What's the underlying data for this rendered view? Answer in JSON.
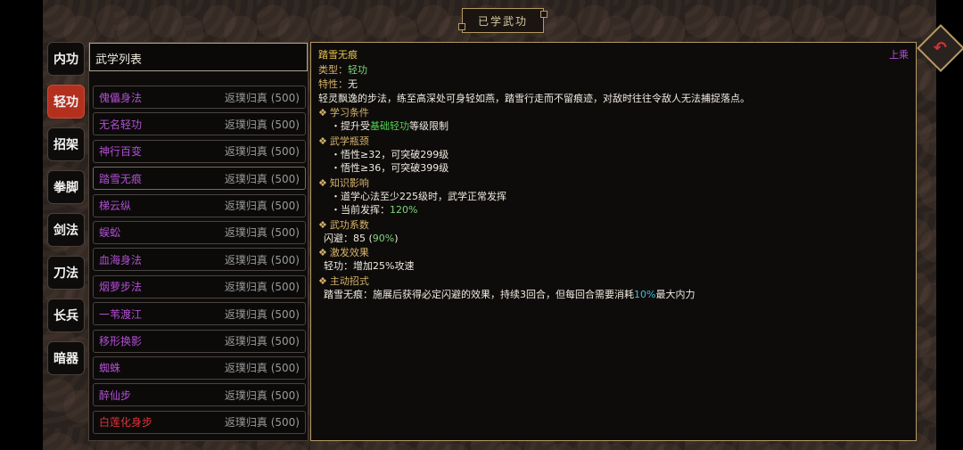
{
  "window_title": "已学武功",
  "tabs": [
    {
      "label": "内功"
    },
    {
      "label": "轻功"
    },
    {
      "label": "招架"
    },
    {
      "label": "拳脚"
    },
    {
      "label": "剑法"
    },
    {
      "label": "刀法"
    },
    {
      "label": "长兵"
    },
    {
      "label": "暗器"
    }
  ],
  "list": {
    "header": "武学列表",
    "rows": [
      {
        "name": "傀儡身法",
        "rank": "返璞归真 (500)",
        "color": "#b24fd3"
      },
      {
        "name": "无名轻功",
        "rank": "返璞归真 (500)",
        "color": "#b24fd3"
      },
      {
        "name": "神行百变",
        "rank": "返璞归真 (500)",
        "color": "#b24fd3"
      },
      {
        "name": "踏雪无痕",
        "rank": "返璞归真 (500)",
        "color": "#b24fd3"
      },
      {
        "name": "梯云纵",
        "rank": "返璞归真 (500)",
        "color": "#b24fd3"
      },
      {
        "name": "蜈蚣",
        "rank": "返璞归真 (500)",
        "color": "#b24fd3"
      },
      {
        "name": "血海身法",
        "rank": "返璞归真 (500)",
        "color": "#b24fd3"
      },
      {
        "name": "烟萝步法",
        "rank": "返璞归真 (500)",
        "color": "#b24fd3"
      },
      {
        "name": "一苇渡江",
        "rank": "返璞归真 (500)",
        "color": "#b24fd3"
      },
      {
        "name": "移形换影",
        "rank": "返璞归真 (500)",
        "color": "#b24fd3"
      },
      {
        "name": "蜘蛛",
        "rank": "返璞归真 (500)",
        "color": "#b24fd3"
      },
      {
        "name": "醉仙步",
        "rank": "返璞归真 (500)",
        "color": "#b24fd3"
      },
      {
        "name": "白莲化身步",
        "rank": "返璞归真 (500)",
        "color": "#e0343a"
      }
    ]
  },
  "detail": {
    "title": "踏雪无痕",
    "equip_label": "上乘",
    "type_key": "类型：",
    "type_val": "轻功",
    "trait_key": "特性：",
    "trait_val": "无",
    "description": "轻灵飘逸的步法，练至高深处可身轻如燕，踏雪行走而不留痕迹，对敌时往往令敌人无法捕捉落点。",
    "sec_learn": "学习条件",
    "learn_prefix": "・提升受",
    "learn_green": "基础轻功",
    "learn_suffix": "等级限制",
    "sec_bottleneck": "武学瓶颈",
    "bottleneck_1": "・悟性≥32，可突破299级",
    "bottleneck_2": "・悟性≥36，可突破399级",
    "sec_knowledge": "知识影响",
    "knowledge_1": "・道学心法至少225级时，武学正常发挥",
    "knowledge_2_prefix": "・当前发挥：",
    "knowledge_2_val": "120%",
    "sec_coef": "武功系数",
    "coef_prefix": "闪避：85 (",
    "coef_val": "90%",
    "coef_suffix": ")",
    "sec_trigger": "激发效果",
    "trigger_text": "轻功：增加25%攻速",
    "sec_active": "主动招式",
    "active_prefix": "踏雪无痕：施展后获得必定闪避的效果，持续3回合，但每回合需要消耗",
    "active_val": "10%",
    "active_suffix": "最大内力"
  },
  "icons": {
    "return": "return-arrow-icon",
    "section": "diamond-bullet-icon"
  }
}
